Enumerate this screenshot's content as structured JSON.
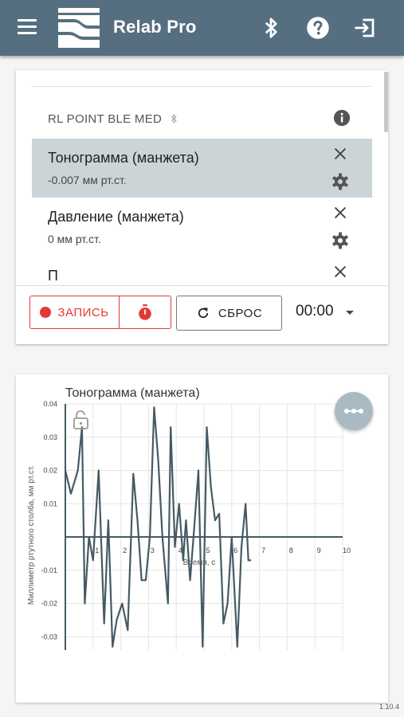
{
  "app": {
    "title": "Relab Pro",
    "accent": "#566f80",
    "version": "1.10.4"
  },
  "device": {
    "name": "RL POINT BLE MED"
  },
  "channels": [
    {
      "name": "Тонограмма (манжета)",
      "value": "-0.007 мм рт.ст.",
      "selected": true
    },
    {
      "name": "Давление (манжета)",
      "value": "0 мм рт.ст.",
      "selected": false
    },
    {
      "name": "П",
      "value": "",
      "selected": false
    }
  ],
  "controls": {
    "record_label": "ЗАПИСЬ",
    "reset_label": "СБРОС",
    "time": "00:00"
  },
  "chart_data": {
    "type": "line",
    "title": "Тонограмма (манжета)",
    "xlabel": "Время, с",
    "ylabel": "Миллиметр ртутного столба, мм рт.ст.",
    "xlim": [
      0,
      10
    ],
    "ylim": [
      -0.034,
      0.04
    ],
    "x_ticks": [
      "1",
      "2",
      "3",
      "4",
      "5",
      "6",
      "7",
      "8",
      "9",
      "10"
    ],
    "y_ticks": [
      "0.04",
      "0.03",
      "0.02",
      "0.01",
      "-0.01",
      "-0.02",
      "-0.03"
    ],
    "series": [
      {
        "color": "#455a64",
        "x": [
          0,
          0.2,
          0.45,
          0.6,
          0.7,
          0.85,
          1.0,
          1.2,
          1.4,
          1.55,
          1.7,
          1.85,
          2.05,
          2.25,
          2.45,
          2.6,
          2.75,
          2.9,
          3.05,
          3.2,
          3.35,
          3.5,
          3.7,
          3.8,
          3.95,
          4.1,
          4.25,
          4.35,
          4.5,
          4.65,
          4.8,
          4.95,
          5.1,
          5.25,
          5.4,
          5.55,
          5.7,
          5.85,
          6.0,
          6.2,
          6.35,
          6.5,
          6.6,
          6.7
        ],
        "y": [
          0.02,
          0.013,
          0.02,
          0.033,
          -0.02,
          0.0,
          -0.007,
          0.02,
          -0.026,
          0.005,
          -0.033,
          -0.025,
          -0.02,
          -0.028,
          0.019,
          0.005,
          -0.013,
          -0.013,
          0.0,
          0.039,
          0.023,
          0.0,
          -0.02,
          0.033,
          -0.003,
          0.01,
          -0.007,
          0.005,
          -0.013,
          0.003,
          0.02,
          -0.033,
          0.033,
          0.015,
          0.005,
          0.007,
          -0.026,
          -0.02,
          0.0,
          -0.033,
          -0.003,
          0.01,
          -0.007,
          -0.007
        ]
      }
    ],
    "grid": true,
    "baseline": 0
  }
}
